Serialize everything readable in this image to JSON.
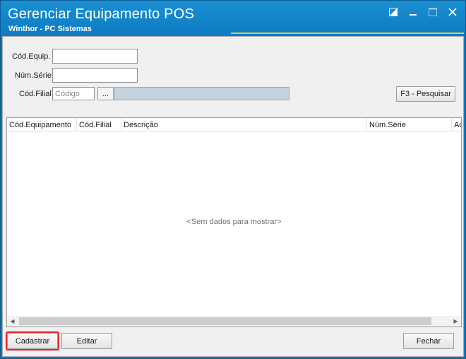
{
  "window": {
    "title": "Gerenciar Equipamento POS",
    "subtitle": "Winthor - PC Sistemas",
    "controls": [
      "maximize-alt-icon",
      "minimize-icon",
      "restore-icon",
      "close-icon"
    ]
  },
  "filters": {
    "cod_equip_label": "Cód.Equip.",
    "cod_equip_value": "",
    "num_serie_label": "Núm.Série",
    "num_serie_value": "",
    "cod_filial_label": "Cód.Filial",
    "cod_filial_placeholder": "Código",
    "lookup_button_label": "...",
    "search_button_label": "F3 - Pesquisar"
  },
  "grid": {
    "columns": [
      "Cód.Equipamento",
      "Cód.Filial",
      "Descrição",
      "Núm.Série",
      "Ac"
    ],
    "rows": [],
    "empty_message": "<Sem dados para mostrar>"
  },
  "actions": {
    "cadastrar_label": "Cadastrar",
    "editar_label": "Editar",
    "fechar_label": "Fechar"
  },
  "colors": {
    "titlebar": "#1a8fd1",
    "accent": "#e6c84a",
    "highlight": "#e3262b"
  }
}
